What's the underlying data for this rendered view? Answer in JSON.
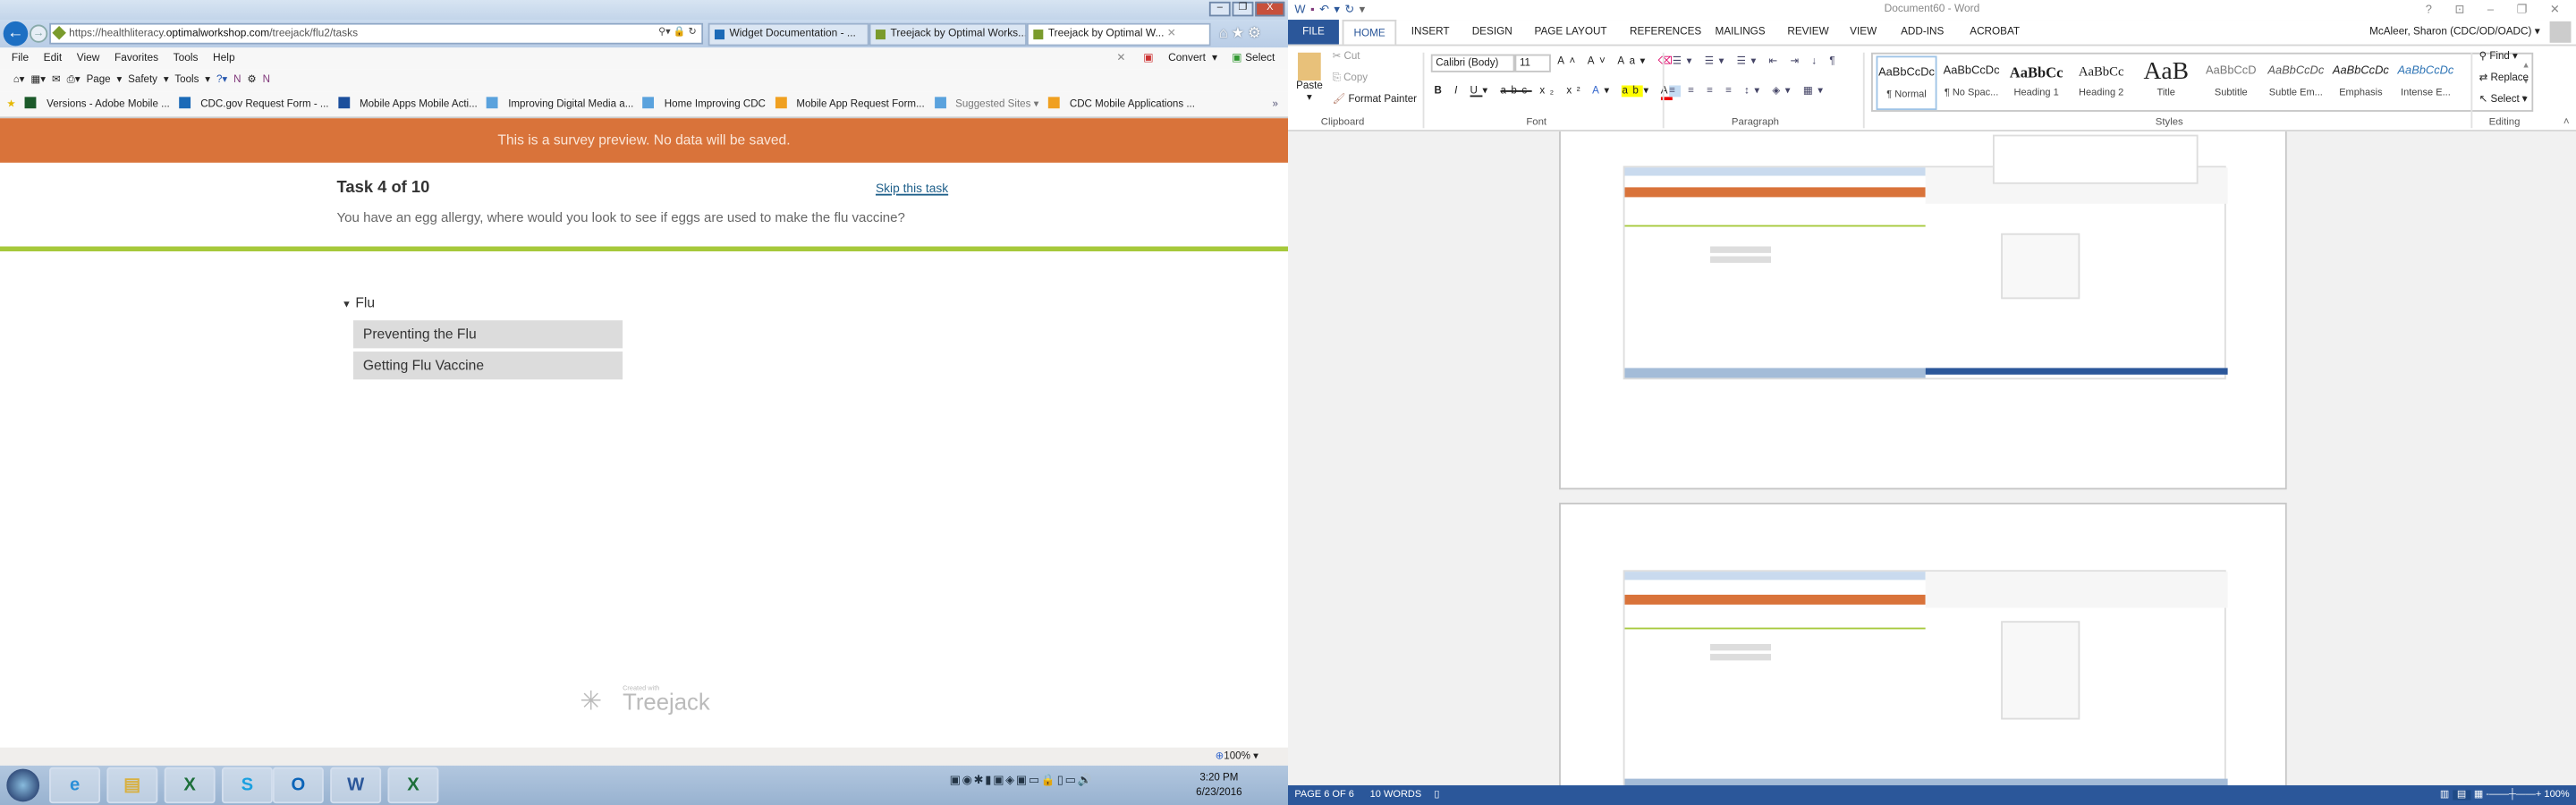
{
  "browser": {
    "address": {
      "prefix": "https://healthliteracy.",
      "domain": "optimalworkshop.com",
      "path": "/treejack/flu2/tasks"
    },
    "tabs": [
      {
        "label": "Widget Documentation - ...",
        "icon": "sharepoint-icon"
      },
      {
        "label": "Treejack by Optimal Works...",
        "icon": "treejack-icon"
      },
      {
        "label": "Treejack by Optimal W...",
        "icon": "treejack-icon",
        "active": true
      }
    ],
    "menu": [
      "File",
      "Edit",
      "View",
      "Favorites",
      "Tools",
      "Help"
    ],
    "menu_right": {
      "convert": "Convert",
      "select": "Select"
    },
    "command_bar": [
      "Page ▾",
      "Safety ▾",
      "Tools ▾"
    ],
    "favorites": [
      "Versions - Adobe Mobile ...",
      "CDC.gov Request Form - ...",
      "Mobile Apps  Mobile Acti...",
      "Improving Digital Media a...",
      "Home  Improving CDC",
      "Mobile App Request Form...",
      "Suggested Sites ▾",
      "CDC Mobile Applications ..."
    ],
    "zoom": "100%"
  },
  "survey": {
    "banner": "This is a survey preview. No data will be saved.",
    "banner_color": "#d9733a",
    "task_title": "Task 4 of 10",
    "skip_label": "Skip this task",
    "question": "You have an egg allergy, where would you look to see if eggs are used to make the flu vaccine?",
    "tree_root": "Flu",
    "tree_items": [
      "Preventing the Flu",
      "Getting Flu Vaccine"
    ],
    "logo": {
      "created_with": "Created with",
      "name": "Treejack"
    }
  },
  "taskbar": {
    "time": "3:20 PM",
    "date": "6/23/2016",
    "apps": [
      "ie",
      "explorer",
      "excel",
      "skype",
      "outlook",
      "word",
      "excel"
    ]
  },
  "word": {
    "title": "Document60 - Word",
    "tabs": [
      "FILE",
      "HOME",
      "INSERT",
      "DESIGN",
      "PAGE LAYOUT",
      "REFERENCES",
      "MAILINGS",
      "REVIEW",
      "VIEW",
      "ADD-INS",
      "ACROBAT"
    ],
    "user": "McAleer, Sharon (CDC/OD/OADC)",
    "clipboard": {
      "paste": "Paste",
      "cut": "Cut",
      "copy": "Copy",
      "format_painter": "Format Painter",
      "label": "Clipboard"
    },
    "font": {
      "name": "Calibri (Body)",
      "size": "11",
      "label": "Font"
    },
    "paragraph_label": "Paragraph",
    "styles_label": "Styles",
    "styles": [
      {
        "sample": "AaBbCcDc",
        "name": "¶ Normal"
      },
      {
        "sample": "AaBbCcDc",
        "name": "¶ No Spac..."
      },
      {
        "sample": "AaBbCc",
        "name": "Heading 1"
      },
      {
        "sample": "AaBbCc",
        "name": "Heading 2"
      },
      {
        "sample": "AaB",
        "name": "Title"
      },
      {
        "sample": "AaBbCcD",
        "name": "Subtitle"
      },
      {
        "sample": "AaBbCcDc",
        "name": "Subtle Em..."
      },
      {
        "sample": "AaBbCcDc",
        "name": "Emphasis"
      },
      {
        "sample": "AaBbCcDc",
        "name": "Intense E..."
      }
    ],
    "editing": {
      "find": "Find ▾",
      "replace": "Replace",
      "select": "Select ▾",
      "label": "Editing"
    },
    "status": {
      "page": "PAGE 6 OF 6",
      "words": "10 WORDS",
      "zoom": "100%"
    },
    "accent": "#2b579a"
  }
}
